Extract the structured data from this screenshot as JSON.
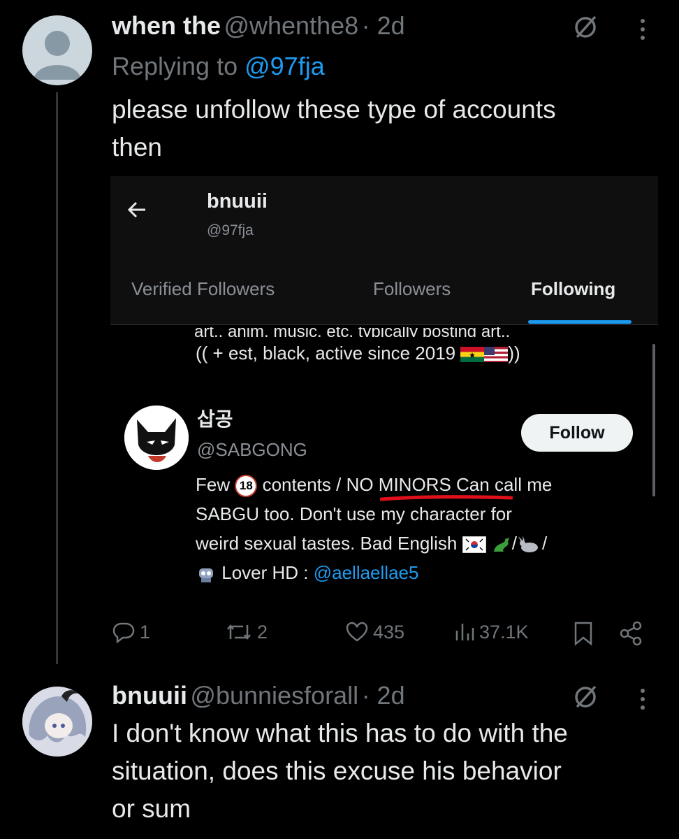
{
  "tweet1": {
    "name": "when the",
    "handle": "@whenthe8",
    "time": "· 2d",
    "replying_prefix": "Replying to ",
    "replying_handle": "@97fja",
    "text_line1": "please unfollow these type of accounts",
    "text_line2": "then"
  },
  "embedded": {
    "profile_name": "bnuuii",
    "profile_handle": "@97fja",
    "tabs": [
      "Verified Followers",
      "Followers",
      "Following"
    ],
    "cut_text": "art,, anim, music, etc. typically posting art,,",
    "bio_prev": "(( + est, black, active since 2019",
    "bio_prev_end": "))",
    "user_name": "삽공",
    "user_handle": "@SABGONG",
    "follow_label": "Follow",
    "bio_line1_a": "Few",
    "badge_18": "18",
    "bio_line1_b": "contents /",
    "bio_line1_c": "NO MINORS",
    "bio_line1_d": "Can call me",
    "bio_line2": "SABGU too. Don't use my character for",
    "bio_line3": "weird sexual tastes. Bad English",
    "bio_line3_end": "/",
    "bio_line4_a": "Lover HD :",
    "bio_line4_link": "@aellaellae5",
    "slash": "/"
  },
  "actions": {
    "replies": "1",
    "reposts": "2",
    "likes": "435",
    "views": "37.1K"
  },
  "tweet2": {
    "name": "bnuuii",
    "handle": "@bunniesforall",
    "time": "· 2d",
    "text_line1": "I don't know what this has to do with the",
    "text_line2": "situation, does this excuse his behavior",
    "text_line3": "or sum"
  },
  "colors": {
    "accent": "#1d9bf0",
    "muted": "#71767b",
    "underline": "#e0101a"
  },
  "icons": [
    "default-avatar-icon",
    "grok-icon",
    "more-icon",
    "back-arrow-icon",
    "reply-icon",
    "repost-icon",
    "like-icon",
    "views-icon",
    "bookmark-icon",
    "share-icon"
  ]
}
